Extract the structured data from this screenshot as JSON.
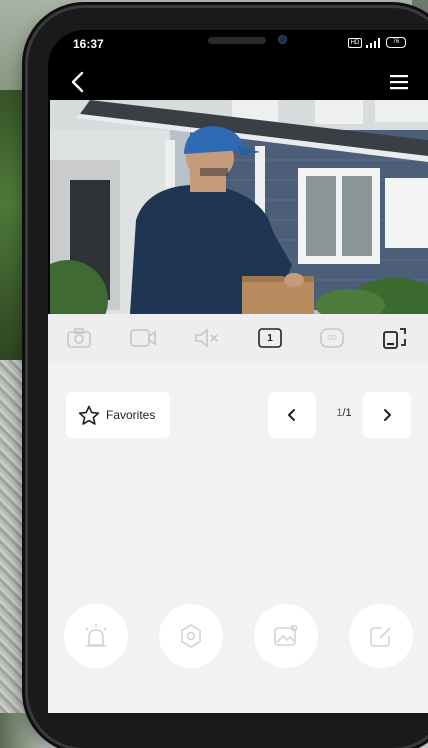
{
  "status_bar": {
    "time": "16:37",
    "battery": "76"
  },
  "app_bar": {
    "back_icon": "chevron-left-icon",
    "menu_icon": "hamburger-menu-icon"
  },
  "video": {
    "description_icon": "live-camera-feed"
  },
  "controls": {
    "items": [
      {
        "icon": "camera-snapshot-icon",
        "enabled": false
      },
      {
        "icon": "video-record-icon",
        "enabled": false
      },
      {
        "icon": "speaker-muted-icon",
        "enabled": false
      },
      {
        "icon": "single-view-icon",
        "label": "1",
        "enabled": true
      },
      {
        "icon": "quality-sd-icon",
        "label": "SD",
        "enabled": false
      },
      {
        "icon": "fullscreen-rotate-icon",
        "enabled": true
      }
    ]
  },
  "panel": {
    "favorites_label": "Favorites",
    "pager": {
      "current": "1",
      "separator": "/",
      "total": "1"
    },
    "actions": [
      "siren-icon",
      "hexagon-settings-icon",
      "gallery-icon",
      "edit-icon"
    ]
  },
  "colors": {
    "accent": "#d9302b",
    "panel_bg": "#f2f2f2",
    "controls_bg": "#eeeeee"
  }
}
